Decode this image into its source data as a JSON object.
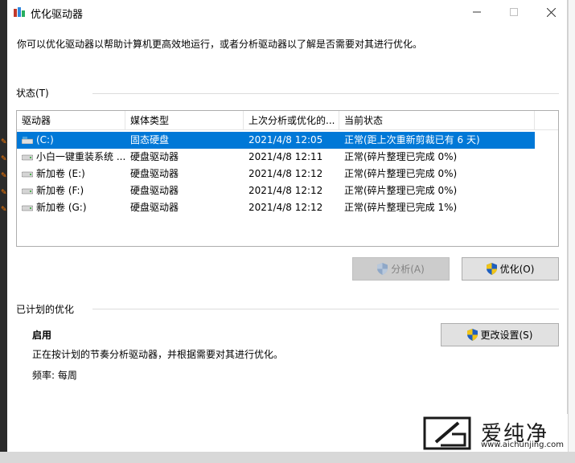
{
  "window": {
    "title": "优化驱动器",
    "description": "你可以优化驱动器以帮助计算机更高效地运行，或者分析驱动器以了解是否需要对其进行优化。"
  },
  "status_section": {
    "label": "状态(T)",
    "columns": [
      "驱动器",
      "媒体类型",
      "上次分析或优化的...",
      "当前状态"
    ],
    "rows": [
      {
        "drive": "(C:)",
        "media": "固态硬盘",
        "last": "2021/4/8 12:05",
        "status": "正常(距上次重新剪裁已有 6 天)",
        "icon": "ssd-drive-icon",
        "selected": true
      },
      {
        "drive": "小白一键重装系统 ...",
        "media": "硬盘驱动器",
        "last": "2021/4/8 12:11",
        "status": "正常(碎片整理已完成 0%)",
        "icon": "hard-drive-icon",
        "selected": false
      },
      {
        "drive": "新加卷 (E:)",
        "media": "硬盘驱动器",
        "last": "2021/4/8 12:12",
        "status": "正常(碎片整理已完成 0%)",
        "icon": "hard-drive-icon",
        "selected": false
      },
      {
        "drive": "新加卷 (F:)",
        "media": "硬盘驱动器",
        "last": "2021/4/8 12:12",
        "status": "正常(碎片整理已完成 0%)",
        "icon": "hard-drive-icon",
        "selected": false
      },
      {
        "drive": "新加卷 (G:)",
        "media": "硬盘驱动器",
        "last": "2021/4/8 12:12",
        "status": "正常(碎片整理已完成 1%)",
        "icon": "hard-drive-icon",
        "selected": false
      }
    ],
    "analyze_label": "分析(A)",
    "optimize_label": "优化(O)"
  },
  "scheduled_section": {
    "label": "已计划的优化",
    "state": "启用",
    "detail": "正在按计划的节奏分析驱动器，并根据需要对其进行优化。",
    "frequency": "频率: 每周",
    "change_settings_label": "更改设置(S)"
  },
  "watermark": {
    "text": "爱纯净",
    "url": "www.aichunjing.com"
  },
  "colors": {
    "selection": "#0078d7",
    "button_bg": "#e1e1e1",
    "button_disabled_bg": "#cccccc"
  }
}
